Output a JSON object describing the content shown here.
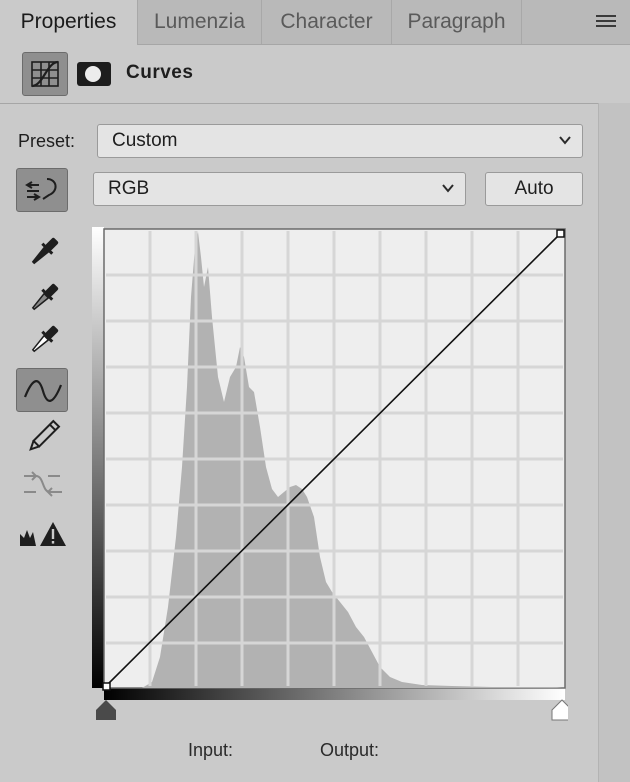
{
  "tabs": [
    {
      "label": "Properties",
      "active": true
    },
    {
      "label": "Lumenzia",
      "active": false
    },
    {
      "label": "Character",
      "active": false
    },
    {
      "label": "Paragraph",
      "active": false
    }
  ],
  "header": {
    "title": "Curves",
    "icons": [
      "curves-adjustment-icon",
      "layer-mask-icon"
    ]
  },
  "preset": {
    "label": "Preset:",
    "value": "Custom"
  },
  "channel": {
    "value": "RGB"
  },
  "auto_button": {
    "label": "Auto"
  },
  "tools": [
    "on-image-adjust-icon",
    "black-point-eyedropper-icon",
    "gray-point-eyedropper-icon",
    "white-point-eyedropper-icon",
    "curve-points-icon",
    "pencil-icon",
    "smooth-curve-icon",
    "clipping-warning-icon"
  ],
  "curve": {
    "points": [
      [
        0,
        0
      ],
      [
        255,
        255
      ]
    ]
  },
  "footer": {
    "input_label": "Input:",
    "output_label": "Output:"
  },
  "colors": {
    "panel": "#cacaca",
    "tab_bar": "#b9b9b9",
    "histogram": "#b3b3b3",
    "grid_bg": "#eeeeee"
  }
}
